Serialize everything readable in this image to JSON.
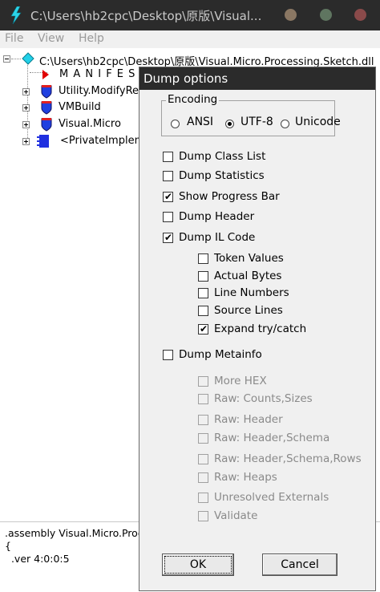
{
  "window": {
    "title": "C:\\Users\\hb2cpc\\Desktop\\原版\\Visual...",
    "controls": [
      "minimize",
      "maximize",
      "close"
    ],
    "icon": "lightning-icon"
  },
  "menu": [
    "File",
    "View",
    "Help"
  ],
  "tree": {
    "root_label": "C:\\Users\\hb2cpc\\Desktop\\原版\\Visual.Micro.Processing.Sketch.dll",
    "manifest_label": "M A N I F E S T",
    "children": [
      {
        "label": "Utility.ModifyReg",
        "icon": "namespace-shield-icon"
      },
      {
        "label": "VMBuild",
        "icon": "namespace-shield-icon"
      },
      {
        "label": "Visual.Micro",
        "icon": "namespace-shield-icon"
      },
      {
        "label": "<PrivateImpleme",
        "icon": "class-icon"
      }
    ]
  },
  "il_pane": {
    "lines": [
      ".assembly Visual.Micro.Proce",
      "{",
      "  .ver 4:0:0:5"
    ]
  },
  "dialog": {
    "title": "Dump options",
    "encoding": {
      "legend": "Encoding",
      "options": [
        "ANSI",
        "UTF-8",
        "Unicode"
      ],
      "selected": "UTF-8"
    },
    "options": [
      {
        "label": "Dump Class List",
        "checked": false,
        "enabled": true
      },
      {
        "label": "Dump Statistics",
        "checked": false,
        "enabled": true
      },
      {
        "label": "Show Progress Bar",
        "checked": true,
        "enabled": true
      },
      {
        "label": "Dump Header",
        "checked": false,
        "enabled": true
      },
      {
        "label": "Dump IL Code",
        "checked": true,
        "enabled": true
      }
    ],
    "il_options": [
      {
        "label": "Token Values",
        "checked": false,
        "enabled": true
      },
      {
        "label": "Actual Bytes",
        "checked": false,
        "enabled": true
      },
      {
        "label": "Line Numbers",
        "checked": false,
        "enabled": true
      },
      {
        "label": "Source Lines",
        "checked": false,
        "enabled": true
      },
      {
        "label": "Expand try/catch",
        "checked": true,
        "enabled": true
      }
    ],
    "metainfo": {
      "label": "Dump Metainfo",
      "checked": false,
      "enabled": true
    },
    "meta_options": [
      {
        "label": "More HEX",
        "checked": false,
        "enabled": false
      },
      {
        "label": "Raw: Counts,Sizes",
        "checked": false,
        "enabled": false
      },
      {
        "label": "Raw: Header",
        "checked": false,
        "enabled": false
      },
      {
        "label": "Raw: Header,Schema",
        "checked": false,
        "enabled": false
      },
      {
        "label": "Raw: Header,Schema,Rows",
        "checked": false,
        "enabled": false
      },
      {
        "label": "Raw: Heaps",
        "checked": false,
        "enabled": false
      },
      {
        "label": "Unresolved Externals",
        "checked": false,
        "enabled": false
      },
      {
        "label": "Validate",
        "checked": false,
        "enabled": false
      }
    ],
    "ok_label": "OK",
    "cancel_label": "Cancel"
  },
  "colors": {
    "titlebar": "#2b2b2b",
    "win_controls": [
      "#8a7763",
      "#5f7560",
      "#8a4a4a"
    ],
    "shield": "#2040e0",
    "accent_cyan": "#00c8e8",
    "manifest_red": "#e00000"
  }
}
